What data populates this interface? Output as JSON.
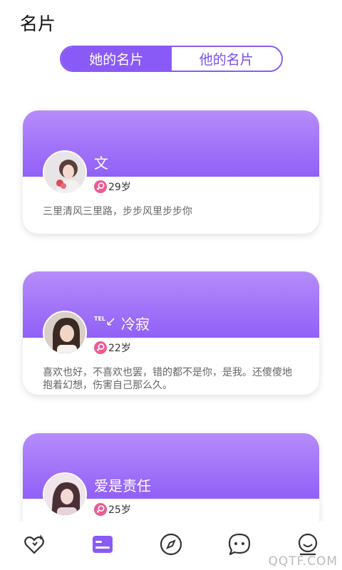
{
  "header": {
    "title": "名片"
  },
  "tabs": [
    {
      "label": "她的名片",
      "active": true
    },
    {
      "label": "他的名片",
      "active": false
    }
  ],
  "cards": [
    {
      "name": "文",
      "age": "29岁",
      "signature": "三里清风三里路，步步风里步步你"
    },
    {
      "name_prefix": "TEL",
      "name_arrow": "↙",
      "name": "冷寂",
      "age": "22岁",
      "signature": "喜欢也好，不喜欢也罢，错的都不是你，是我。还傻傻地抱着幻想，伤害自己那么久。"
    },
    {
      "name": "爱是责任",
      "age": "25岁"
    }
  ],
  "bottom_nav": [
    {
      "icon": "heart-icon"
    },
    {
      "icon": "card-icon",
      "active": true
    },
    {
      "icon": "compass-icon"
    },
    {
      "icon": "chat-icon"
    },
    {
      "icon": "smiley-icon"
    }
  ],
  "watermark": "QQTF.COM",
  "colors": {
    "accent": "#8a5af7",
    "gender_female": "#ee5a93"
  }
}
